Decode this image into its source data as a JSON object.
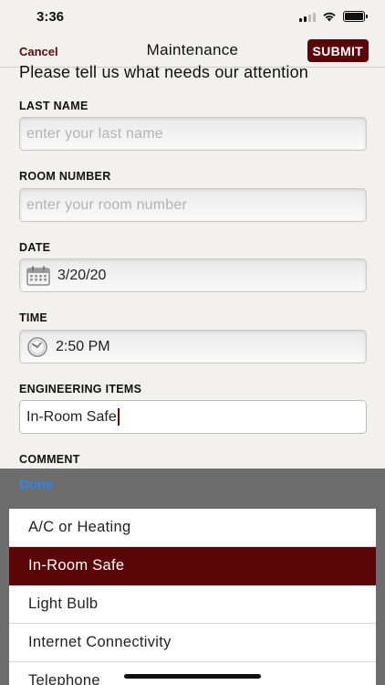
{
  "status_bar": {
    "time": "3:36"
  },
  "navbar": {
    "cancel": "Cancel",
    "title": "Maintenance",
    "submit": "SUBMIT"
  },
  "form": {
    "intro": "Please tell us what needs our attention",
    "last_name": {
      "label": "LAST NAME",
      "placeholder": "enter your last name"
    },
    "room_number": {
      "label": "ROOM NUMBER",
      "placeholder": "enter your room number"
    },
    "date": {
      "label": "DATE",
      "value": "3/20/20"
    },
    "time": {
      "label": "TIME",
      "value": "2:50 PM"
    },
    "engineering_items": {
      "label": "ENGINEERING ITEMS",
      "value": "In-Room Safe"
    },
    "comment": {
      "label": "COMMENT"
    }
  },
  "toolbar": {
    "done": "Done"
  },
  "picker": {
    "options": [
      "A/C or Heating",
      "In-Room Safe",
      "Light Bulb",
      "Internet Connectivity",
      "Telephone"
    ],
    "selected": "In-Room Safe"
  },
  "colors": {
    "brand": "#5a0508",
    "done": "#2f86e8",
    "toolbar": "#6d6d6d"
  }
}
